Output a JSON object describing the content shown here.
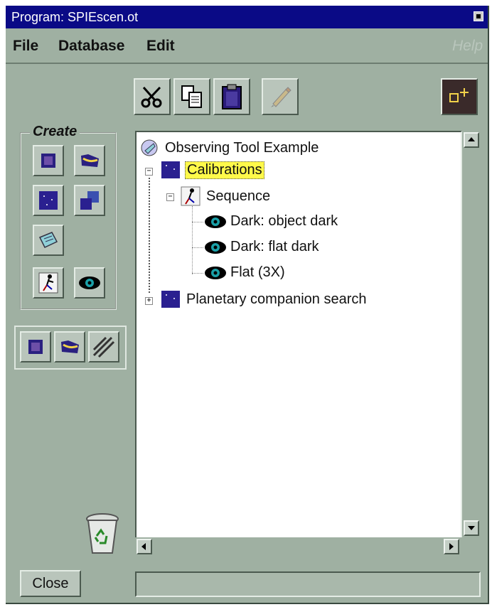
{
  "window": {
    "title": "Program: SPIEscen.ot"
  },
  "menu": {
    "file": "File",
    "database": "Database",
    "edit": "Edit",
    "help": "Help"
  },
  "toolbar": {
    "cut_icon": "scissors-icon",
    "copy_icon": "copy-icon",
    "paste_icon": "clipboard-icon",
    "edit_icon": "pencil-icon",
    "corner_icon": "add-target-icon"
  },
  "create": {
    "label": "Create"
  },
  "tree": {
    "root": "Observing Tool Example",
    "calibrations": "Calibrations",
    "sequence": "Sequence",
    "items": [
      "Dark: object dark",
      "Dark: flat dark",
      "Flat (3X)"
    ],
    "planetary": "Planetary companion search"
  },
  "buttons": {
    "close": "Close"
  },
  "colors": {
    "window_bg": "#9fb0a2",
    "titlebar": "#0a0a86",
    "selection": "#fff94a",
    "tree_bg": "#ffffff"
  }
}
